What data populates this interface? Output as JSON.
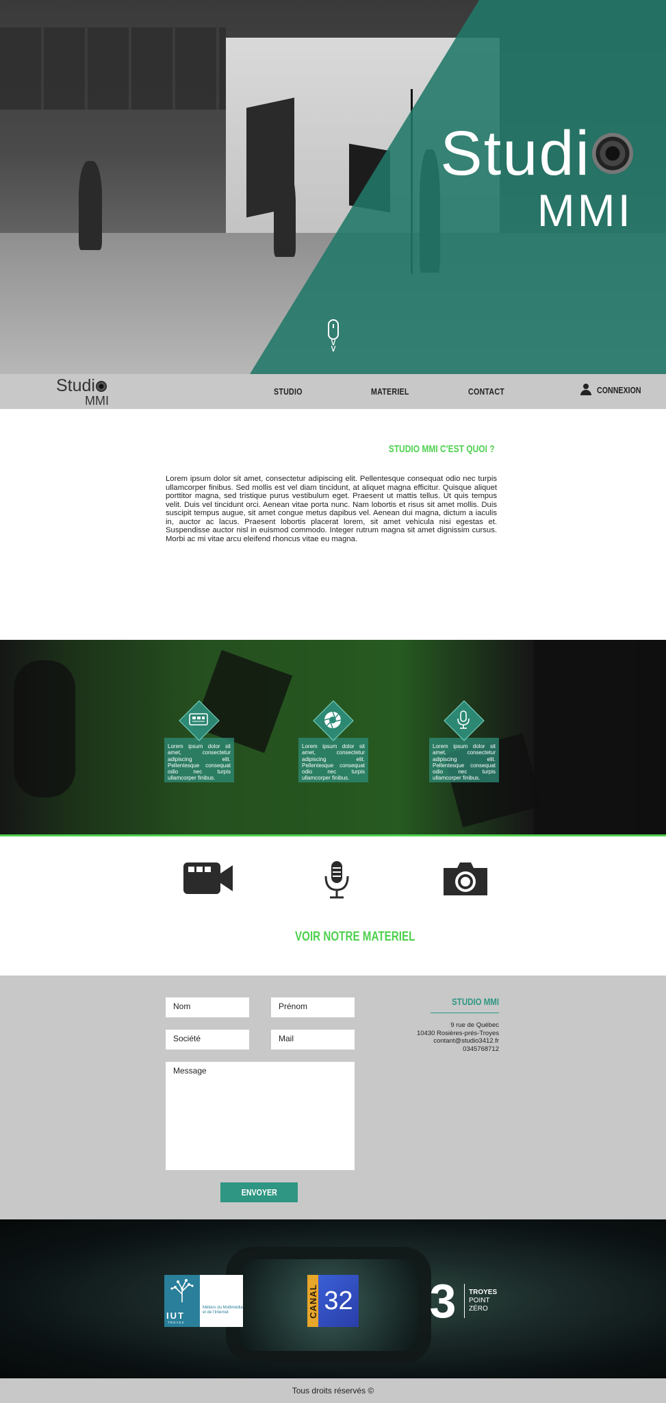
{
  "hero": {
    "title_line1": "Studi",
    "title_line2": "MMI"
  },
  "nav": {
    "logo_line1": "Studi",
    "logo_line2": "MMI",
    "items": [
      {
        "label": "STUDIO"
      },
      {
        "label": "MATERIEL"
      },
      {
        "label": "CONTACT"
      }
    ],
    "login_label": "CONNEXION"
  },
  "about": {
    "heading": "STUDIO MMI C'EST QUOI ?",
    "body": "Lorem ipsum dolor sit amet, consectetur adipiscing elit. Pellentesque consequat odio nec turpis ullamcorper finibus. Sed mollis est vel diam tincidunt, at aliquet magna efficitur. Quisque aliquet porttitor magna, sed tristique purus vestibulum eget. Praesent ut mattis tellus. Ut quis tempus velit. Duis vel tincidunt orci. Aenean vitae porta nunc. Nam lobortis et risus sit amet mollis. Duis suscipit tempus augue, sit amet congue metus dapibus vel. Aenean dui magna, dictum a iaculis in, auctor ac lacus. Praesent lobortis placerat lorem, sit amet vehicula nisi egestas et. Suspendisse auctor nisl in euismod commodo. Integer rutrum magna sit amet dignissim cursus. Morbi ac mi vitae arcu eleifend rhoncus vitae eu magna."
  },
  "features": [
    {
      "icon": "screen-icon",
      "text": "Lorem ipsum dolor sit amet, consectetur adipiscing elit. Pellentesque consequat odio nec turpis ullamcorper finibus."
    },
    {
      "icon": "aperture-icon",
      "text": "Lorem ipsum dolor sit amet, consectetur adipiscing elit. Pellentesque consequat odio nec turpis ullamcorper finibus."
    },
    {
      "icon": "microphone-icon",
      "text": "Lorem ipsum dolor sit amet, consectetur adipiscing elit. Pellentesque consequat odio nec turpis ullamcorper finibus."
    }
  ],
  "equipment": {
    "icons": [
      "video-camera-icon",
      "microphone-icon",
      "camera-icon"
    ],
    "cta_label": "VOIR NOTRE MATERIEL"
  },
  "contact": {
    "fields": {
      "nom": "Nom",
      "prenom": "Prénom",
      "societe": "Société",
      "mail": "Mail",
      "message": "Message"
    },
    "submit_label": "ENVOYER",
    "info_title": "STUDIO MMI",
    "address_line1": "9 rue de Québec",
    "address_line2": "10430 Rosières-prés-Troyes",
    "email": "contant@studio3412.fr",
    "phone": "0345768712"
  },
  "partners": {
    "iut_label": "IUT",
    "iut_city": "TROYES",
    "iut_dept": "Métiers du Multimédia et de l'Internet",
    "canal_name": "CANAL",
    "canal_number": "32",
    "tpz_line1": "TROYES",
    "tpz_line2": "POINT",
    "tpz_line3": "ZÉRO"
  },
  "footer": {
    "text": "Tous droits réservés ©"
  },
  "colors": {
    "accent_green": "#4ed04e",
    "teal": "#2e9682",
    "nav_gray": "#c8c8c8"
  }
}
